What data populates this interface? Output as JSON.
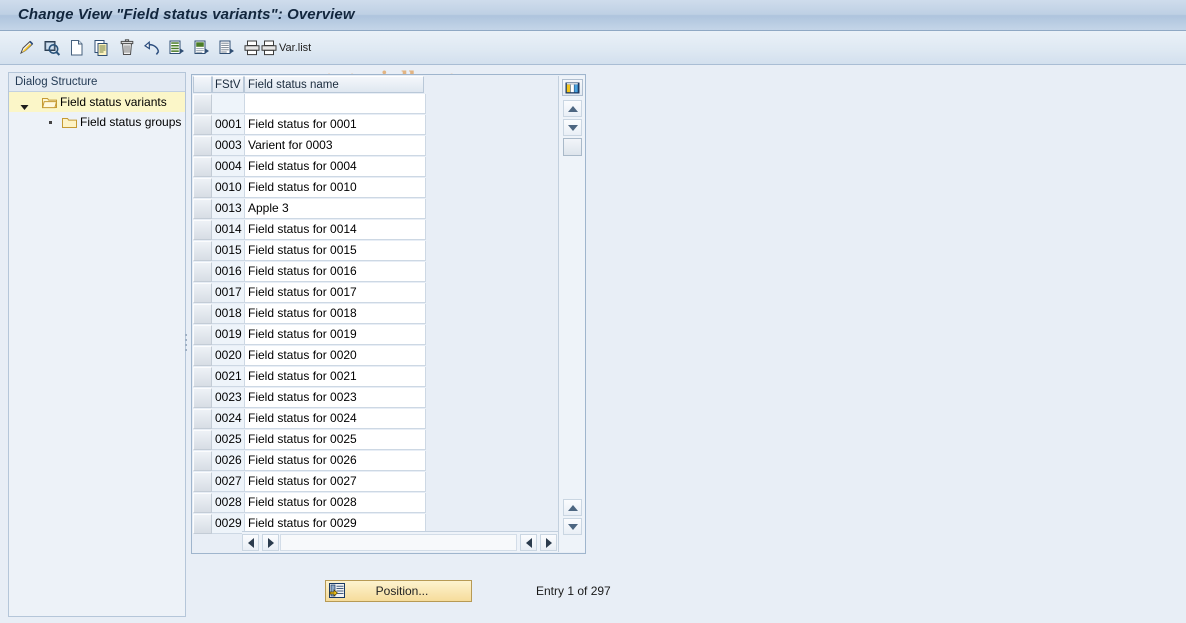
{
  "window": {
    "title": "Change View \"Field status variants\": Overview"
  },
  "watermark": "www.tutorialkart.com",
  "toolbar": {
    "items": [
      {
        "name": "edit-pencil-icon",
        "label": ""
      },
      {
        "name": "display-magnifier-icon",
        "label": ""
      },
      {
        "name": "new-entries-icon",
        "label": ""
      },
      {
        "name": "copy-as-icon",
        "label": ""
      },
      {
        "name": "delete-trash-icon",
        "label": ""
      },
      {
        "name": "undo-change-icon",
        "label": ""
      },
      {
        "name": "select-all-list-icon",
        "label": ""
      },
      {
        "name": "deselect-all-list-icon",
        "label": ""
      },
      {
        "name": "select-block-list-icon",
        "label": ""
      },
      {
        "name": "print-icon",
        "label": ""
      },
      {
        "name": "print-variant-list-icon",
        "label": "Var.list"
      }
    ]
  },
  "tree": {
    "header": "Dialog Structure",
    "items": [
      {
        "label": "Field status variants",
        "selected": true,
        "expanded": true,
        "icon": "open-folder-icon"
      },
      {
        "label": "Field status groups",
        "selected": false,
        "expanded": false,
        "icon": "closed-folder-icon"
      }
    ]
  },
  "table": {
    "columns": [
      "FStV",
      "Field status name"
    ],
    "new_entry_row": {
      "key": "",
      "name": ""
    },
    "rows": [
      {
        "key": "0001",
        "name": "Field status for 0001"
      },
      {
        "key": "0003",
        "name": "Varient for 0003"
      },
      {
        "key": "0004",
        "name": "Field status for 0004"
      },
      {
        "key": "0010",
        "name": "Field status for 0010"
      },
      {
        "key": "0013",
        "name": "Apple 3"
      },
      {
        "key": "0014",
        "name": "Field status for 0014"
      },
      {
        "key": "0015",
        "name": "Field status for 0015"
      },
      {
        "key": "0016",
        "name": "Field status for 0016"
      },
      {
        "key": "0017",
        "name": "Field status for 0017"
      },
      {
        "key": "0018",
        "name": "Field status for 0018"
      },
      {
        "key": "0019",
        "name": "Field status for 0019"
      },
      {
        "key": "0020",
        "name": "Field status for 0020"
      },
      {
        "key": "0021",
        "name": "Field status for 0021"
      },
      {
        "key": "0023",
        "name": "Field status for 0023"
      },
      {
        "key": "0024",
        "name": "Field status for 0024"
      },
      {
        "key": "0025",
        "name": "Field status for 0025"
      },
      {
        "key": "0026",
        "name": "Field status for 0026"
      },
      {
        "key": "0027",
        "name": "Field status for 0027"
      },
      {
        "key": "0028",
        "name": "Field status for 0028"
      },
      {
        "key": "0029",
        "name": "Field status for 0029"
      }
    ]
  },
  "footer": {
    "position_button": "Position...",
    "entry_status": "Entry 1 of 297"
  },
  "colors": {
    "title_bar": "#bed0e4",
    "selection_highlight": "#fbf6c8",
    "button_yellow": "#f6dc9b",
    "watermark": "#e2b07a"
  }
}
